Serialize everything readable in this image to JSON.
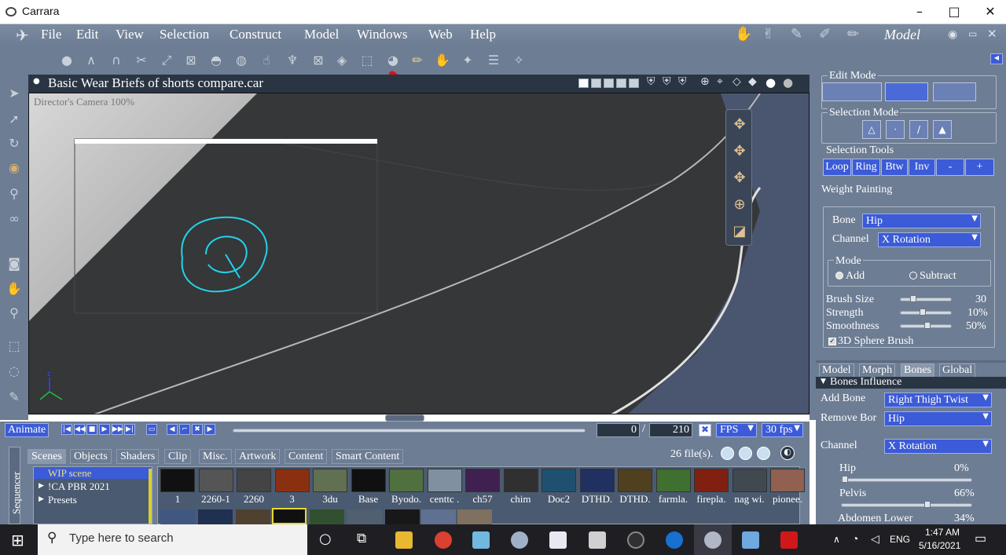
{
  "window": {
    "title": "Carrara",
    "min": "–",
    "max": "□",
    "close": "✕"
  },
  "menu": [
    "File",
    "Edit",
    "View",
    "Selection",
    "Construct",
    "Model",
    "Windows",
    "Web",
    "Help"
  ],
  "room": "Model",
  "viewport": {
    "title": "Basic Wear Briefs of shorts compare.car",
    "camera": "Director's Camera 100%"
  },
  "panel": {
    "edit_mode": "Edit Mode",
    "selection_mode": "Selection Mode",
    "selection_tools": "Selection Tools",
    "tools": [
      "Loop",
      "Ring",
      "Btw",
      "Inv",
      "-",
      "+"
    ],
    "weight_painting": "Weight Painting",
    "bone_label": "Bone",
    "bone_value": "Hip",
    "channel_label": "Channel",
    "channel_value": "X Rotation",
    "mode_label": "Mode",
    "add_label": "Add",
    "subtract_label": "Subtract",
    "brush_size_label": "Brush Size",
    "brush_size_value": "30",
    "strength_label": "Strength",
    "strength_value": "10%",
    "smoothness_label": "Smoothness",
    "smoothness_value": "50%",
    "sphere_brush_label": "3D Sphere Brush",
    "tabs": [
      "Model",
      "Morph",
      "Bones",
      "Global"
    ],
    "bones_influence": "Bones Influence",
    "add_bone_label": "Add Bone",
    "add_bone_value": "Right Thigh Twist",
    "remove_bone_label": "Remove Bor",
    "remove_bone_value": "Hip",
    "influence_channel_label": "Channel",
    "influence_channel_value": "X Rotation",
    "influences": [
      {
        "name": "Hip",
        "value": "0%",
        "fraction": 0.0
      },
      {
        "name": "Pelvis",
        "value": "66%",
        "fraction": 0.66
      },
      {
        "name": "Abdomen Lower",
        "value": "34%",
        "fraction": 0.34
      }
    ]
  },
  "animation": {
    "animate_label": "Animate",
    "current_frame": "0",
    "separator": "/",
    "total_frames": "210",
    "fps_label": "FPS",
    "fps_value": "30 fps"
  },
  "browser": {
    "tabs": [
      "Scenes",
      "Objects",
      "Shaders",
      "Clip",
      "Misc.",
      "Artwork",
      "Content",
      "Smart Content"
    ],
    "file_count": "26 file(s).",
    "tree": [
      "WIP scene",
      "!CA PBR 2021",
      "Presets"
    ],
    "sequencer": "Sequencer",
    "thumbs": [
      "1",
      "2260-1",
      "2260",
      "3",
      "3du",
      "Base",
      "Byodo.",
      "centtc .",
      "ch57",
      "chim",
      "Doc2",
      "DTHD.",
      "DTHD.",
      "farmla.",
      "firepla.",
      "nag wi.",
      "pionee."
    ]
  },
  "taskbar": {
    "search_placeholder": "Type here to search",
    "lang": "ENG",
    "time": "1:47 AM",
    "date": "5/16/2021"
  },
  "colors": {
    "ui_gray_blue": "#6d7d94",
    "accent_blue": "#3c5bd8",
    "menu_text": "#ffffff",
    "annotation_cyan": "#22d3e8",
    "annotation_red": "#e0101a"
  }
}
